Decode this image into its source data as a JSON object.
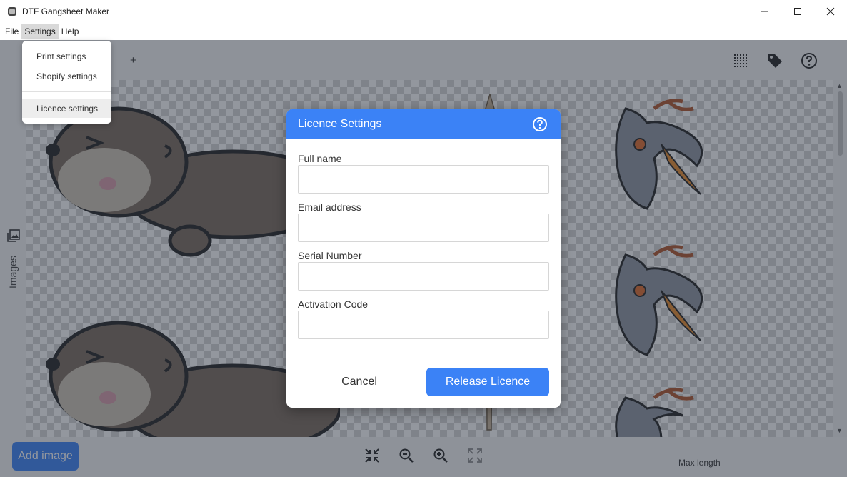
{
  "window": {
    "title": "DTF Gangsheet Maker",
    "icons": [
      "app-icon",
      "minimize-icon",
      "maximize-icon",
      "close-icon"
    ]
  },
  "menubar": {
    "items": [
      {
        "label": "File"
      },
      {
        "label": "Settings",
        "active": true
      },
      {
        "label": "Help"
      }
    ]
  },
  "settings_menu": {
    "items": [
      {
        "label": "Print settings"
      },
      {
        "label": "Shopify settings"
      },
      {
        "label": "Licence settings",
        "highlighted": true
      }
    ]
  },
  "toolbar": {
    "add_tab_label": "+",
    "icons": [
      "grid-icon",
      "tag-icon",
      "help-icon"
    ]
  },
  "side_panel": {
    "label": "Images",
    "icon": "images-icon"
  },
  "bottombar": {
    "add_image_label": "Add image",
    "icons": [
      "fit-icon",
      "zoom-out-icon",
      "zoom-in-icon",
      "fullscreen-icon"
    ],
    "max_length_label": "Max length"
  },
  "dialog": {
    "title": "Licence Settings",
    "fields": [
      {
        "label": "Full name",
        "value": ""
      },
      {
        "label": "Email address",
        "value": ""
      },
      {
        "label": "Serial Number",
        "value": ""
      },
      {
        "label": "Activation Code",
        "value": ""
      }
    ],
    "cancel_label": "Cancel",
    "submit_label": "Release Licence"
  },
  "colors": {
    "accent": "#3b82f6",
    "overlay": "#28303e"
  }
}
